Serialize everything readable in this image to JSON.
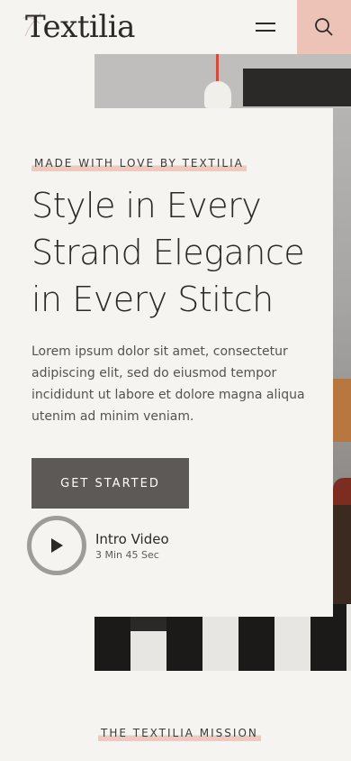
{
  "header": {
    "logo_text": "Textilia",
    "menu_icon": "hamburger-menu-icon",
    "search_icon": "search-icon",
    "accent_color": "#ecc3b6"
  },
  "hero": {
    "eyebrow": "MADE WITH LOVE BY TEXTILIA",
    "headline_lines": [
      "Style in Every",
      "Strand Elegance",
      "in Every Stitch"
    ],
    "description": "Lorem ipsum dolor sit amet, consectetur adipiscing elit, sed do eiusmod tempor incididunt ut labore et dolore magna aliqua utenim ad minim veniam.",
    "cta_label": "GET STARTED",
    "video": {
      "title": "Intro Video",
      "duration": "3 Min 45 Sec",
      "icon": "play-icon"
    }
  },
  "mission": {
    "label": "THE TEXTILIA MISSION"
  }
}
